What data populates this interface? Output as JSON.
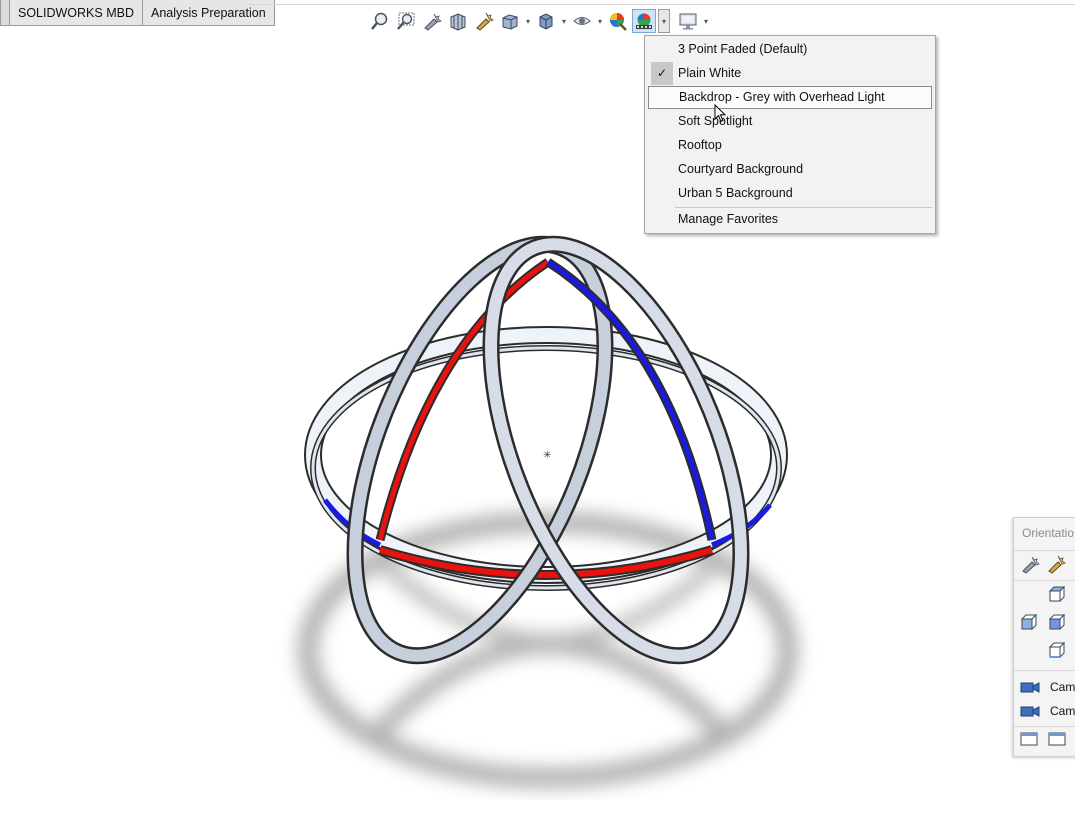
{
  "tabs": [
    {
      "label": ""
    },
    {
      "label": "SOLIDWORKS MBD"
    },
    {
      "label": "Analysis Preparation"
    }
  ],
  "toolbar": {
    "icons": [
      "zoom-to-fit-icon",
      "zoom-to-area-icon",
      "previous-view-icon",
      "section-view-icon",
      "dynamic-annotation-icon",
      "view-orientation-icon",
      "display-style-icon",
      "hide-show-items-icon",
      "edit-appearance-icon",
      "apply-scene-icon",
      "view-settings-icon"
    ]
  },
  "scene_menu": {
    "items": [
      {
        "label": "3 Point Faded  (Default)",
        "checked": false,
        "hovered": false
      },
      {
        "label": "Plain White",
        "checked": true,
        "hovered": false
      },
      {
        "label": "Backdrop - Grey with Overhead Light",
        "checked": false,
        "hovered": true
      },
      {
        "label": "Soft Spotlight",
        "checked": false,
        "hovered": false
      },
      {
        "label": "Rooftop",
        "checked": false,
        "hovered": false
      },
      {
        "label": "Courtyard Background",
        "checked": false,
        "hovered": false
      },
      {
        "label": "Urban 5 Background",
        "checked": false,
        "hovered": false
      }
    ],
    "footer": "Manage Favorites",
    "check_glyph": "✓"
  },
  "orientation_panel": {
    "title": "Orientatio",
    "cameras": [
      "Cam",
      "Cam"
    ]
  },
  "colors": {
    "accent_red": "#e8120e",
    "accent_blue": "#1a1ae0",
    "ring_light": "#e7eef7",
    "ring_dark": "#6f7685"
  }
}
